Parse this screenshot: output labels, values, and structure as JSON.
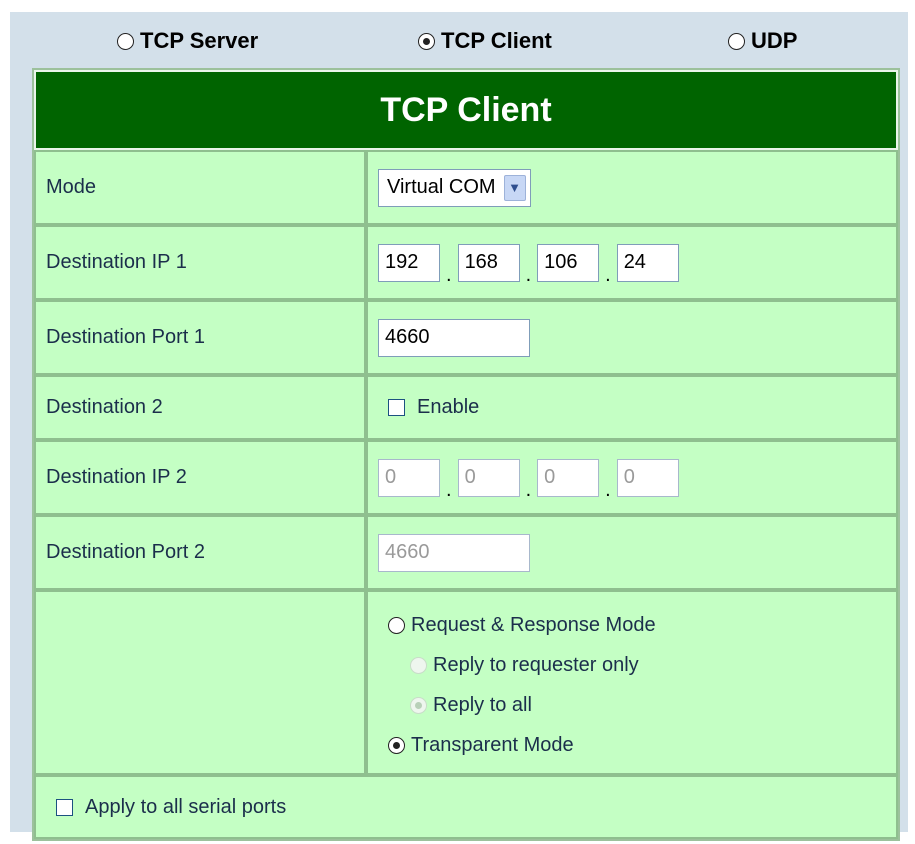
{
  "mode_bar": {
    "options": [
      {
        "label": "TCP Server",
        "selected": false
      },
      {
        "label": "TCP Client",
        "selected": true
      },
      {
        "label": "UDP",
        "selected": false
      }
    ]
  },
  "form": {
    "title": "TCP Client",
    "mode": {
      "label": "Mode",
      "value": "Virtual COM"
    },
    "dest_ip1": {
      "label": "Destination IP 1",
      "octets": [
        "192",
        "168",
        "106",
        "24"
      ]
    },
    "dest_port1": {
      "label": "Destination Port 1",
      "value": "4660"
    },
    "dest2": {
      "label": "Destination 2",
      "checkbox_label": "Enable",
      "checked": false
    },
    "dest_ip2": {
      "label": "Destination IP 2",
      "octets": [
        "0",
        "0",
        "0",
        "0"
      ],
      "disabled": true
    },
    "dest_port2": {
      "label": "Destination Port 2",
      "value": "4660",
      "disabled": true
    },
    "response": {
      "request_response": "Request & Response Mode",
      "reply_requester": "Reply to requester only",
      "reply_all": "Reply to all",
      "transparent": "Transparent Mode",
      "selected": "transparent"
    },
    "apply_all": {
      "label": "Apply to all serial ports",
      "checked": false
    }
  },
  "colors": {
    "header_bg": "#006400",
    "cell_bg": "#c4ffc4",
    "panel_bg": "#d3e0ea"
  }
}
